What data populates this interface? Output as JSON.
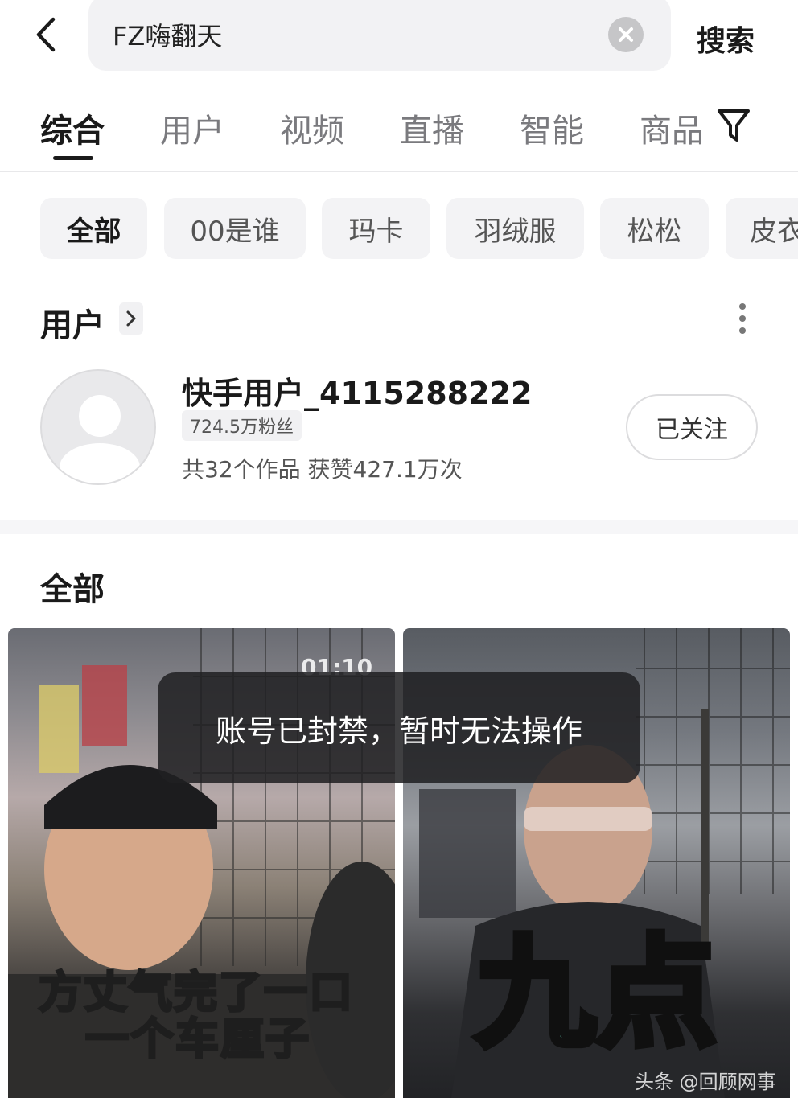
{
  "search": {
    "query": "FZ嗨翻天",
    "submit_label": "搜索"
  },
  "tabs": [
    {
      "label": "综合",
      "active": true
    },
    {
      "label": "用户",
      "active": false
    },
    {
      "label": "视频",
      "active": false
    },
    {
      "label": "直播",
      "active": false
    },
    {
      "label": "智能",
      "active": false
    },
    {
      "label": "商品",
      "active": false
    }
  ],
  "chips": [
    {
      "label": "全部",
      "active": true
    },
    {
      "label": "00是谁",
      "active": false
    },
    {
      "label": "玛卡",
      "active": false
    },
    {
      "label": "羽绒服",
      "active": false
    },
    {
      "label": "松松",
      "active": false
    },
    {
      "label": "皮衣",
      "active": false
    }
  ],
  "users_section": {
    "title": "用户",
    "user": {
      "name": "快手用户_4115288222",
      "fans": "724.5万粉丝",
      "stats": "共32个作品 获赞427.1万次",
      "follow_label": "已关注"
    }
  },
  "all_section": {
    "title": "全部"
  },
  "videos": [
    {
      "duration": "01:10",
      "caption_line1": "方丈气完了一口",
      "caption_line2": "一个车厘子"
    },
    {
      "caption_big": "九点",
      "watermark": "头条 @回顾网事"
    }
  ],
  "toast": {
    "message": "账号已封禁，暂时无法操作"
  },
  "colors": {
    "accent_caption_yellow": "#f5d34a",
    "accent_caption_teal": "#6fe3c6",
    "toast_bg": "#202022"
  },
  "icons": [
    "back-arrow-icon",
    "clear-icon",
    "filter-icon",
    "chevron-right-icon",
    "more-vertical-icon",
    "default-avatar-icon"
  ]
}
